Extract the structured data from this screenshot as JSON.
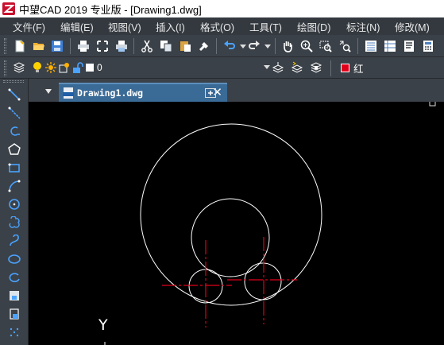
{
  "window": {
    "title": "中望CAD 2019 专业版 - [Drawing1.dwg]"
  },
  "menubar": {
    "items": [
      {
        "label": "文件(F)"
      },
      {
        "label": "编辑(E)"
      },
      {
        "label": "视图(V)"
      },
      {
        "label": "插入(I)"
      },
      {
        "label": "格式(O)"
      },
      {
        "label": "工具(T)"
      },
      {
        "label": "绘图(D)"
      },
      {
        "label": "标注(N)"
      },
      {
        "label": "修改(M)"
      }
    ]
  },
  "layer_bar": {
    "current_layer": "0",
    "current_color_name": "红",
    "current_color": "#e0001b"
  },
  "document_tab": {
    "label": "Drawing1.dwg"
  },
  "canvas": {
    "ucs_axis_label": "Y",
    "background": "#000000",
    "geometry_color": "#ffffff",
    "centerline_color": "#e0001b"
  }
}
